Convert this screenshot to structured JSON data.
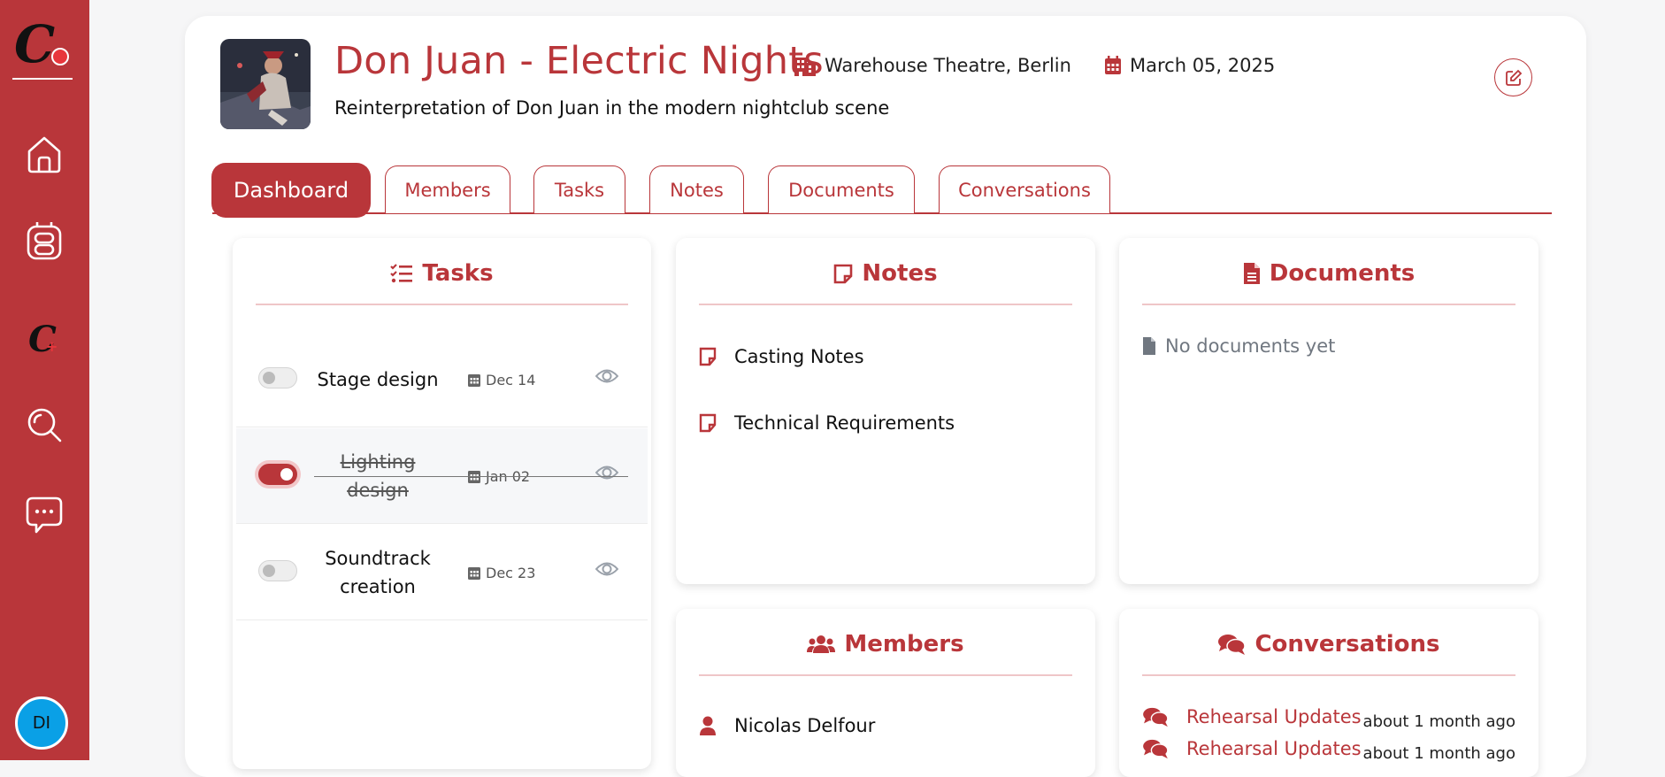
{
  "sidebar": {
    "logo_letter": "C",
    "items": [
      {
        "icon": "home-icon"
      },
      {
        "icon": "calendar-icon"
      },
      {
        "icon": "create-icon"
      },
      {
        "icon": "search-icon"
      },
      {
        "icon": "chat-icon"
      }
    ],
    "avatar_initials": "DI"
  },
  "colors": {
    "accent": "#b9363a",
    "avatar": "#0aa0e6"
  },
  "project": {
    "title": "Don Juan - Electric Nights",
    "venue": "Warehouse Theatre, Berlin",
    "date": "March 05, 2025",
    "description": "Reinterpretation of Don Juan in the modern nightclub scene"
  },
  "tabs": [
    {
      "label": "Dashboard",
      "active": true
    },
    {
      "label": "Members"
    },
    {
      "label": "Tasks"
    },
    {
      "label": "Notes"
    },
    {
      "label": "Documents"
    },
    {
      "label": "Conversations"
    }
  ],
  "tasks_panel": {
    "title": "Tasks",
    "items": [
      {
        "name": "Stage design",
        "date": "Dec 14",
        "done": false
      },
      {
        "name": "Lighting design",
        "date": "Jan 02",
        "done": true
      },
      {
        "name": "Soundtrack creation",
        "date": "Dec 23",
        "done": false
      }
    ]
  },
  "notes_panel": {
    "title": "Notes",
    "items": [
      "Casting Notes",
      "Technical Requirements"
    ]
  },
  "documents_panel": {
    "title": "Documents",
    "empty_text": "No documents yet"
  },
  "members_panel": {
    "title": "Members",
    "items": [
      "Nicolas Delfour"
    ]
  },
  "conversations_panel": {
    "title": "Conversations",
    "items": [
      {
        "title": "Rehearsal Updates",
        "time": "about 1 month ago"
      },
      {
        "title": "Rehearsal Updates",
        "time": "about 1 month ago"
      }
    ]
  }
}
